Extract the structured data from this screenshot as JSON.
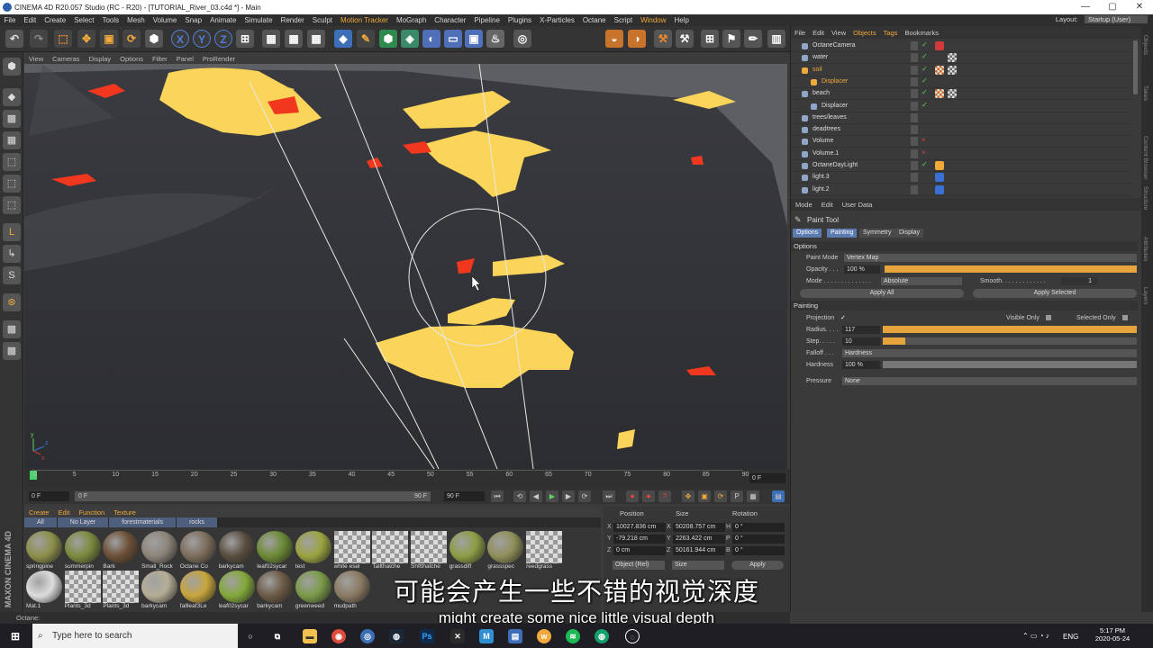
{
  "window": {
    "title": "CINEMA 4D R20.057 Studio (RC - R20) - [TUTORIAL_River_03.c4d *] - Main",
    "controls": [
      "—",
      "▢",
      "✕"
    ]
  },
  "menubar": {
    "items": [
      "File",
      "Edit",
      "Create",
      "Select",
      "Tools",
      "Mesh",
      "Volume",
      "Snap",
      "Animate",
      "Simulate",
      "Render",
      "Sculpt",
      "Motion Tracker",
      "MoGraph",
      "Character",
      "Pipeline",
      "Plugins",
      "X-Particles",
      "Octane",
      "Script",
      "Window",
      "Help"
    ],
    "highlight": [
      "Motion Tracker",
      "Window"
    ],
    "layout_label": "Layout:",
    "layout_value": "Startup (User)"
  },
  "viewport": {
    "menu": [
      "View",
      "Cameras",
      "Display",
      "Options",
      "Filter",
      "Panel",
      "ProRender"
    ],
    "axis_labels": [
      "y",
      "z",
      "x"
    ]
  },
  "timeline": {
    "ticks": [
      "0",
      "5",
      "10",
      "15",
      "20",
      "25",
      "30",
      "35",
      "40",
      "45",
      "50",
      "55",
      "60",
      "65",
      "70",
      "75",
      "80",
      "85",
      "90"
    ],
    "end_frame": "0 F",
    "current": "0 F",
    "start_field": "0 F",
    "end_field": "90 F",
    "end_field2": "90 F"
  },
  "material_manager": {
    "menu": [
      "Create",
      "Edit",
      "Function",
      "Texture"
    ],
    "tabs": [
      "All",
      "No Layer",
      "forestmaterials",
      "rocks"
    ],
    "row1": [
      {
        "name": "springpine",
        "color": "#8c8f4a"
      },
      {
        "name": "summerpin",
        "color": "#7a8a3c"
      },
      {
        "name": "Bark",
        "color": "#6b4e36"
      },
      {
        "name": "Small_Rock",
        "color": "#8c8479"
      },
      {
        "name": "Octane Co",
        "color": "#7d6d5c"
      },
      {
        "name": "barkycam",
        "color": "#5a4d40"
      },
      {
        "name": "leaf02sycar",
        "color": "#6b8a34"
      },
      {
        "name": "test",
        "color": "#9aa43f"
      },
      {
        "name": "white esel",
        "color": "#aaa"
      },
      {
        "name": "Tallthatche",
        "color": "#aaa"
      },
      {
        "name": "Shftthatche",
        "color": "#aaa"
      },
      {
        "name": "grassdiff",
        "color": "#8b9e44"
      },
      {
        "name": "grassspec",
        "color": "#8f8f5a"
      },
      {
        "name": "reedgrass",
        "color": "#aaa"
      }
    ],
    "row2": [
      {
        "name": "Mat.1",
        "color": "#ddd"
      },
      {
        "name": "Plants_3d",
        "color": "#aaa"
      },
      {
        "name": "Plants_3d",
        "color": "#aaa"
      },
      {
        "name": "barkycam",
        "color": "#b5ad95"
      },
      {
        "name": "fallleaf3Le",
        "color": "#c8a53b"
      },
      {
        "name": "leaf02sycar",
        "color": "#83a83a"
      },
      {
        "name": "barkycam",
        "color": "#6c5a45"
      },
      {
        "name": "greenweed",
        "color": "#7a9a48"
      },
      {
        "name": "mudpath",
        "color": "#8a7a62"
      }
    ]
  },
  "coordinates": {
    "headers": [
      "Position",
      "Size",
      "Rotation"
    ],
    "rows": [
      {
        "axis": "X",
        "pos": "10027.836 cm",
        "sizeAxis": "X",
        "size": "50208.757 cm",
        "rotAxis": "H",
        "rot": "0 °"
      },
      {
        "axis": "Y",
        "pos": "-79.218 cm",
        "sizeAxis": "Y",
        "size": "2263.422 cm",
        "rotAxis": "P",
        "rot": "0 °"
      },
      {
        "axis": "Z",
        "pos": "0 cm",
        "sizeAxis": "Z",
        "size": "50161.944 cm",
        "rotAxis": "B",
        "rot": "0 °"
      }
    ],
    "mode": "Object (Rel)",
    "size_mode": "Size",
    "apply": "Apply"
  },
  "object_manager": {
    "menu": [
      "File",
      "Edit",
      "View",
      "Objects",
      "Tags",
      "Bookmarks"
    ],
    "objects": [
      {
        "name": "OctaneCamera",
        "indent": 0,
        "orange": false
      },
      {
        "name": "water",
        "indent": 0,
        "orange": false
      },
      {
        "name": "soil",
        "indent": 0,
        "orange": true
      },
      {
        "name": "Displacer",
        "indent": 1,
        "orange": true
      },
      {
        "name": "beach",
        "indent": 0,
        "orange": false
      },
      {
        "name": "Displacer",
        "indent": 1,
        "orange": false
      },
      {
        "name": "trees/leaves",
        "indent": 0,
        "orange": false
      },
      {
        "name": "deadtrees",
        "indent": 0,
        "orange": false
      },
      {
        "name": "Volume",
        "indent": 0,
        "orange": false
      },
      {
        "name": "Volume.1",
        "indent": 0,
        "orange": false
      },
      {
        "name": "OctaneDayLight",
        "indent": 0,
        "orange": false
      },
      {
        "name": "light.3",
        "indent": 0,
        "orange": false
      },
      {
        "name": "light.2",
        "indent": 0,
        "orange": false
      }
    ]
  },
  "attribute_manager": {
    "menu": [
      "Mode",
      "Edit",
      "User Data"
    ],
    "title": "Paint Tool",
    "tabs": [
      "Options",
      "Painting",
      "Symmetry",
      "Display"
    ],
    "sec_options": "Options",
    "paint_mode_label": "Paint Mode",
    "paint_mode": "Vertex Map",
    "opacity_label": "Opacity . . .",
    "opacity": "100 %",
    "opacity_level": 1.0,
    "mode_label": "Mode . . . . . . . . . . . . . .",
    "mode": "Absolute",
    "smooth_label": "Smooth. . . . . . . . . . . . .",
    "smooth": "1",
    "apply_all": "Apply All",
    "apply_selected": "Apply Selected",
    "sec_painting": "Painting",
    "projection_label": "Projection",
    "projection_check": "✓",
    "visible_only": "Visible Only",
    "selected_only": "Selected Only",
    "radius_label": "Radius. . . .",
    "radius": "117",
    "radius_level": 1.0,
    "step_label": "Step. . . . .",
    "step": "10",
    "step_level": 0.09,
    "falloff_label": "Falloff . . .",
    "falloff": "Hardness",
    "hardness_label": "Hardness",
    "hardness": "100 %",
    "hardness_level": 1.0,
    "pressure_label": "Pressure",
    "pressure": "None"
  },
  "right_strip": [
    "Objects",
    "Takes",
    "Content Browser",
    "Structure",
    "Attributes",
    "Layers"
  ],
  "status": "Octane:",
  "subtitles": {
    "cn": "可能会产生一些不错的视觉深度",
    "en": "might create some nice little visual depth"
  },
  "taskbar": {
    "search": "Type here to search",
    "lang": "ENG",
    "time": "5:17 PM",
    "date": "2020-05-24"
  },
  "brand": "MAXON CINEMA 4D"
}
